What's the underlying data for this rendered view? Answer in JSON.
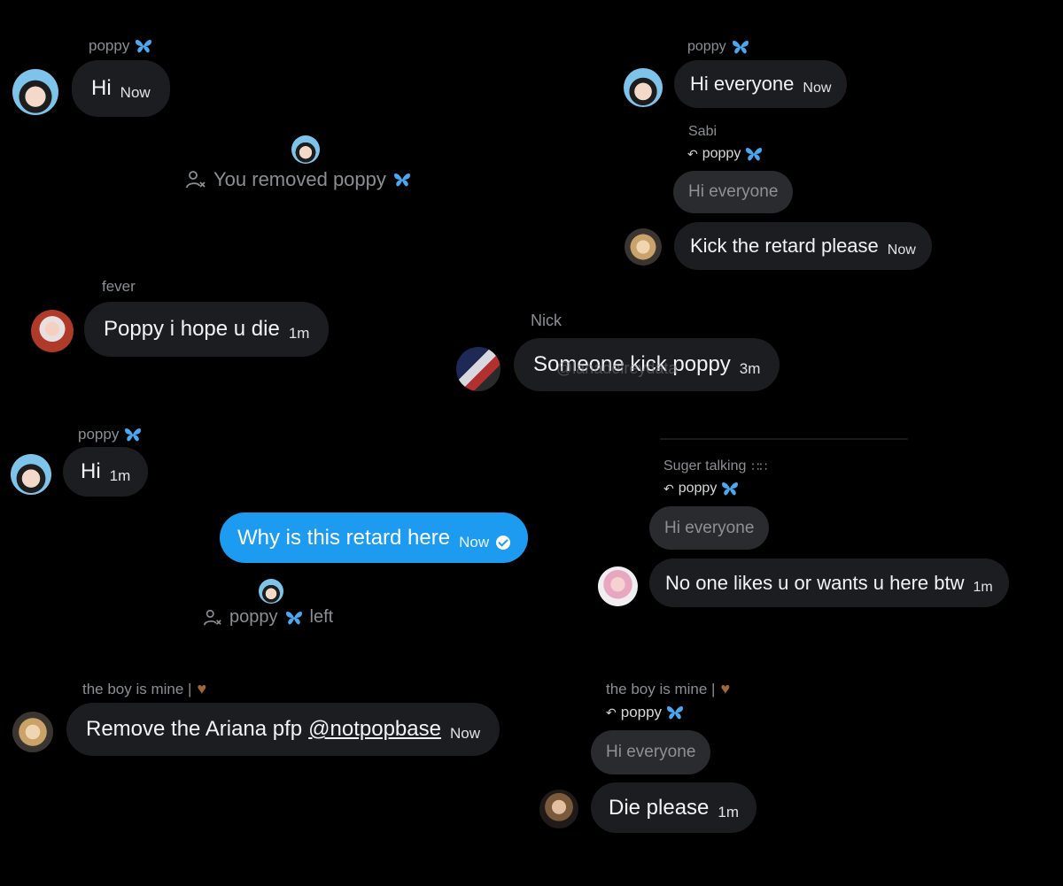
{
  "colors": {
    "background": "#000000",
    "bubble": "#1c1d20",
    "sent_bubble": "#1d9bf0",
    "muted_text": "#8b8e93",
    "butterfly": "#4aa8f0"
  },
  "left": {
    "msg1": {
      "sender": "poppy",
      "text": "Hi",
      "time": "Now"
    },
    "sys1": {
      "text": "You removed poppy"
    },
    "msg2": {
      "sender": "fever",
      "text": "Poppy i hope u die",
      "time": "1m"
    },
    "msg3": {
      "sender": "poppy",
      "text": "Hi",
      "time": "1m"
    },
    "sent": {
      "text": "Why is this retard here",
      "time": "Now"
    },
    "sys2": {
      "name": "poppy",
      "text": "left"
    },
    "msg4": {
      "sender": "the boy is mine |",
      "text": "Remove the Ariana pfp",
      "mention": "@notpopbase",
      "time": "Now"
    }
  },
  "right": {
    "msg1": {
      "sender": "poppy",
      "text": "Hi everyone",
      "time": "Now"
    },
    "msg2": {
      "sender": "Sabi",
      "reply_to": "poppy",
      "quoted": "Hi everyone",
      "text": "Kick the retard please",
      "time": "Now"
    },
    "msg3": {
      "sender": "Nick",
      "text": "Someone kick poppy",
      "time": "3m",
      "watermark": "@lanadelreydata"
    },
    "msg4": {
      "sender": "Suger talking",
      "reply_to": "poppy",
      "quoted": "Hi everyone",
      "text": "No one likes u or wants u here btw",
      "time": "1m"
    },
    "msg5": {
      "sender": "the boy is mine |",
      "reply_to": "poppy",
      "quoted": "Hi everyone",
      "text": "Die please",
      "time": "1m"
    }
  },
  "icons": {
    "butterfly": "butterfly-icon",
    "person_remove": "person-remove-icon",
    "reply": "reply-arrow-icon",
    "heart": "brown-heart-icon",
    "paws": "paw-prints-icon",
    "check": "check-circle-icon"
  }
}
